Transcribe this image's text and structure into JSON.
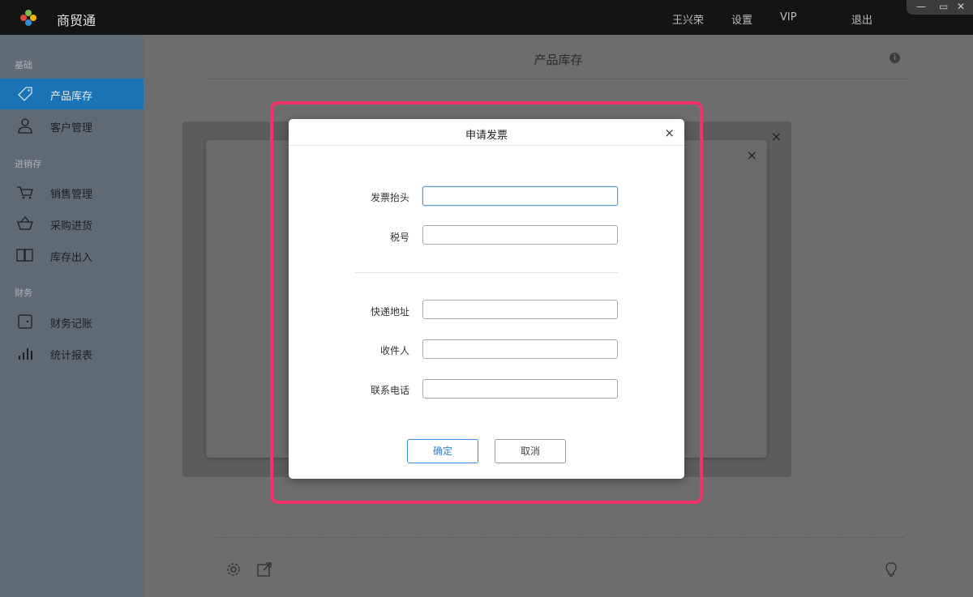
{
  "app": {
    "title": "商贸通"
  },
  "topbar": {
    "user": "王兴荣",
    "settings": "设置",
    "vip": "VIP",
    "logout": "退出",
    "window_controls": {
      "minimize": "—",
      "maximize": "▭",
      "close": "✕"
    }
  },
  "sidebar": {
    "groups": [
      {
        "label": "基础",
        "items": [
          {
            "label": "产品库存",
            "icon": "tag-icon",
            "active": true
          },
          {
            "label": "客户管理",
            "icon": "user-icon",
            "active": false
          }
        ]
      },
      {
        "label": "进销存",
        "items": [
          {
            "label": "销售管理",
            "icon": "cart-icon",
            "active": false
          },
          {
            "label": "采购进货",
            "icon": "basket-icon",
            "active": false
          },
          {
            "label": "库存出入",
            "icon": "book-icon",
            "active": false
          }
        ]
      },
      {
        "label": "财务",
        "items": [
          {
            "label": "财务记账",
            "icon": "wallet-icon",
            "active": false
          },
          {
            "label": "统计报表",
            "icon": "bar-chart-icon",
            "active": false
          }
        ]
      }
    ]
  },
  "main": {
    "title": "产品库存",
    "info_icon": "i",
    "footer_icons": [
      "gear-icon",
      "external-link-icon",
      "lightbulb-icon"
    ]
  },
  "back_dialogs": {
    "close_symbol": "×"
  },
  "dialog": {
    "title": "申请发票",
    "close_symbol": "×",
    "fields": [
      {
        "label": "发票抬头",
        "value": "",
        "focused": true
      },
      {
        "label": "税号",
        "value": "",
        "focused": false
      },
      {
        "label": "快递地址",
        "value": "",
        "focused": false
      },
      {
        "label": "收件人",
        "value": "",
        "focused": false
      },
      {
        "label": "联系电话",
        "value": "",
        "focused": false
      }
    ],
    "confirm_label": "确定",
    "cancel_label": "取消"
  },
  "colors": {
    "topbar_bg": "#141414",
    "sidebar_bg": "#5f6a73",
    "active_item_bg": "#1a73b5",
    "confirm_border": "#3a8be0",
    "highlight": "#f0336a"
  }
}
